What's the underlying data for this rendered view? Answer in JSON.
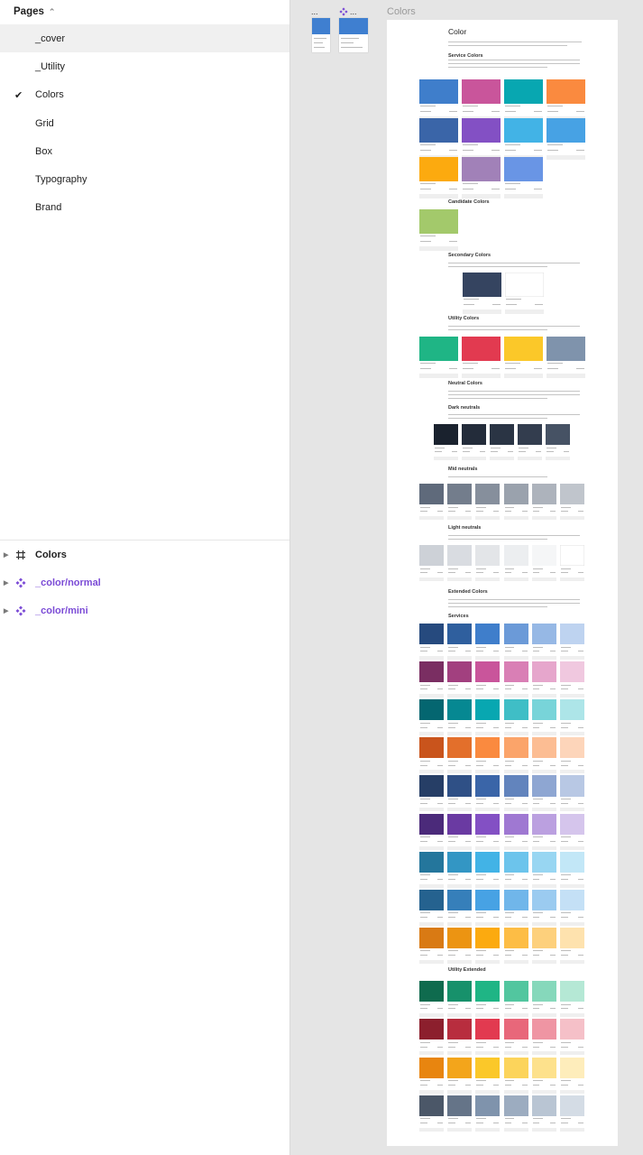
{
  "pages_panel": {
    "title": "Pages",
    "pages": [
      {
        "label": "_cover",
        "selected": true,
        "checked": false
      },
      {
        "label": "_Utility",
        "selected": false,
        "checked": false
      },
      {
        "label": "Colors",
        "selected": false,
        "checked": true
      },
      {
        "label": "Grid",
        "selected": false,
        "checked": false
      },
      {
        "label": "Box",
        "selected": false,
        "checked": false
      },
      {
        "label": "Typography",
        "selected": false,
        "checked": false
      },
      {
        "label": "Brand",
        "selected": false,
        "checked": false
      }
    ]
  },
  "layers_panel": {
    "layers": [
      {
        "label": "Colors",
        "icon": "frame-icon",
        "type": "frame"
      },
      {
        "label": "_color/normal",
        "icon": "component-icon",
        "type": "component"
      },
      {
        "label": "_color/mini",
        "icon": "component-icon",
        "type": "component"
      }
    ]
  },
  "canvas": {
    "thumbnails": [
      {
        "label": "..."
      },
      {
        "label": "..."
      }
    ],
    "frame_label": "Colors",
    "frame": {
      "title": "Color",
      "sections": [
        {
          "heading": "Service Colors",
          "rows": [
            [
              "#3f7ecb",
              "#c9559b",
              "#08a7b1",
              "#fa8a3f"
            ],
            [
              "#3a65a8",
              "#8350c4",
              "#42b3e6",
              "#47a2e4"
            ],
            [
              "#fcaa0f",
              "#a181b8",
              "#6995e5"
            ]
          ]
        },
        {
          "heading": "Candidate Colors",
          "rows": [
            [
              "#a3c96b"
            ]
          ]
        },
        {
          "heading": "Secondary Colors",
          "rows": [
            [
              "#354460",
              "#ffffff"
            ]
          ]
        },
        {
          "heading": "Utility Colors",
          "rows": [
            [
              "#1fb585",
              "#e23a50",
              "#fbc829",
              "#7f93ac"
            ]
          ]
        },
        {
          "heading": "Neutral Colors",
          "rows": []
        },
        {
          "heading": "Dark neutrals",
          "rows": [
            [
              "#1a222e",
              "#232c3a",
              "#2a3444",
              "#333d4e",
              "#465264"
            ]
          ]
        },
        {
          "heading": "Mid neutrals",
          "rows": [
            [
              "#5f6a7b",
              "#737d8c",
              "#868f9c",
              "#9aa2ad",
              "#adb3bc",
              "#c0c5cc"
            ]
          ]
        },
        {
          "heading": "Light neutrals",
          "rows": [
            [
              "#cdd1d7",
              "#d9dce1",
              "#e3e5e8",
              "#eceef0",
              "#f5f6f7",
              "#ffffff"
            ]
          ]
        },
        {
          "heading": "Extended Colors",
          "rows": []
        },
        {
          "heading": "Services",
          "rows": [
            [
              "#264a7e",
              "#2f5f9e",
              "#3f7ecb",
              "#6b9ad8",
              "#96b8e5",
              "#bed3f0"
            ],
            [
              "#7a2e62",
              "#a2407f",
              "#c9559b",
              "#d97fb5",
              "#e6a6cc",
              "#f0c8df"
            ],
            [
              "#046670",
              "#068892",
              "#08a7b1",
              "#3fbec6",
              "#78d4d9",
              "#ade5e8"
            ],
            [
              "#c9541c",
              "#e36f2b",
              "#fa8a3f",
              "#fba46a",
              "#fcbd93",
              "#fdd5ba"
            ],
            [
              "#263e66",
              "#2f5086",
              "#3a65a8",
              "#6284bd",
              "#8ea6d2",
              "#b8c8e4"
            ],
            [
              "#4b2a7a",
              "#6a3aa2",
              "#8350c4",
              "#9f78d2",
              "#bba0e0",
              "#d5c5ec"
            ],
            [
              "#24769c",
              "#3396c4",
              "#42b3e6",
              "#6cc4ec",
              "#98d6f2",
              "#c2e7f7"
            ],
            [
              "#25628f",
              "#367fba",
              "#47a2e4",
              "#70b6ea",
              "#9bcbf0",
              "#c4e0f6"
            ],
            [
              "#d97a14",
              "#ec9412",
              "#fcaa0f",
              "#fdbd45",
              "#fdd07c",
              "#fee2ae"
            ]
          ]
        },
        {
          "heading": "Utility Extended",
          "rows": [
            [
              "#0f6b4e",
              "#17916b",
              "#1fb585",
              "#52c69f",
              "#86d8bb",
              "#b5e8d5"
            ],
            [
              "#8c1f2d",
              "#b82d3e",
              "#e23a50",
              "#e8677a",
              "#ef95a3",
              "#f5c0c8"
            ],
            [
              "#e8850f",
              "#f3a51b",
              "#fbc829",
              "#fcd45b",
              "#fde18c",
              "#feedbb"
            ],
            [
              "#4b5768",
              "#657488",
              "#7f93ac",
              "#9cacc0",
              "#b9c5d3",
              "#d4dce5"
            ]
          ]
        }
      ]
    }
  }
}
